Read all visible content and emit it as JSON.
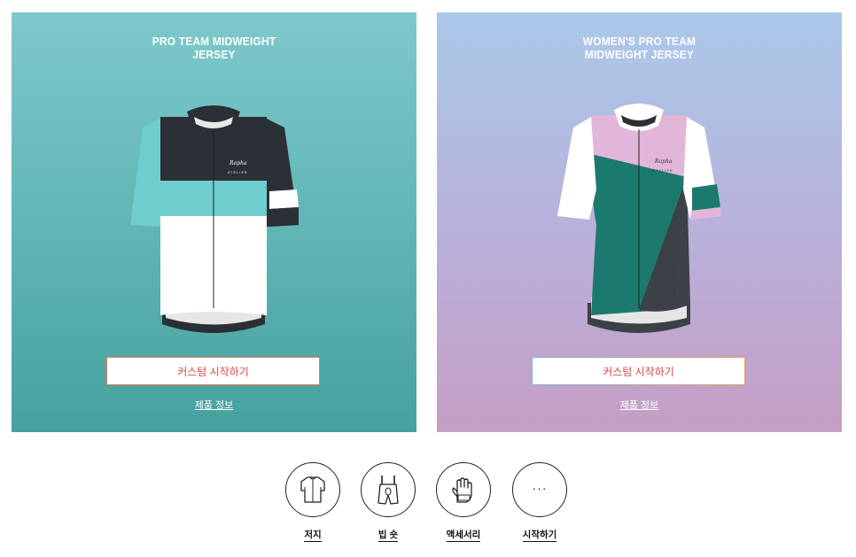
{
  "products": [
    {
      "title": "PRO TEAM MIDWEIGHT\nJERSEY",
      "cta_label": "커스텀 시작하기",
      "info_label": "제품 정보",
      "jersey_brand": "Rapha",
      "jersey_sub": "ATELIER",
      "colors": {
        "dark": "#2b2f36",
        "accent": "#6fcdcd",
        "light": "#ffffff"
      }
    },
    {
      "title": "WOMEN'S PRO TEAM\nMIDWEIGHT JERSEY",
      "cta_label": "커스텀 시작하기",
      "info_label": "제품 정보",
      "jersey_brand": "Rapha",
      "jersey_sub": "ATELIER",
      "colors": {
        "pink": "#e2b6d8",
        "green": "#1b7a6d",
        "dark": "#3c4047",
        "light": "#ffffff"
      }
    }
  ],
  "categories": [
    {
      "label": "저지",
      "icon": "jersey-icon"
    },
    {
      "label": "빕 숏",
      "icon": "bib-shorts-icon"
    },
    {
      "label": "액세서리",
      "icon": "glove-icon"
    },
    {
      "label": "시작하기",
      "icon": "more-dots-icon",
      "glyph": "···"
    }
  ]
}
